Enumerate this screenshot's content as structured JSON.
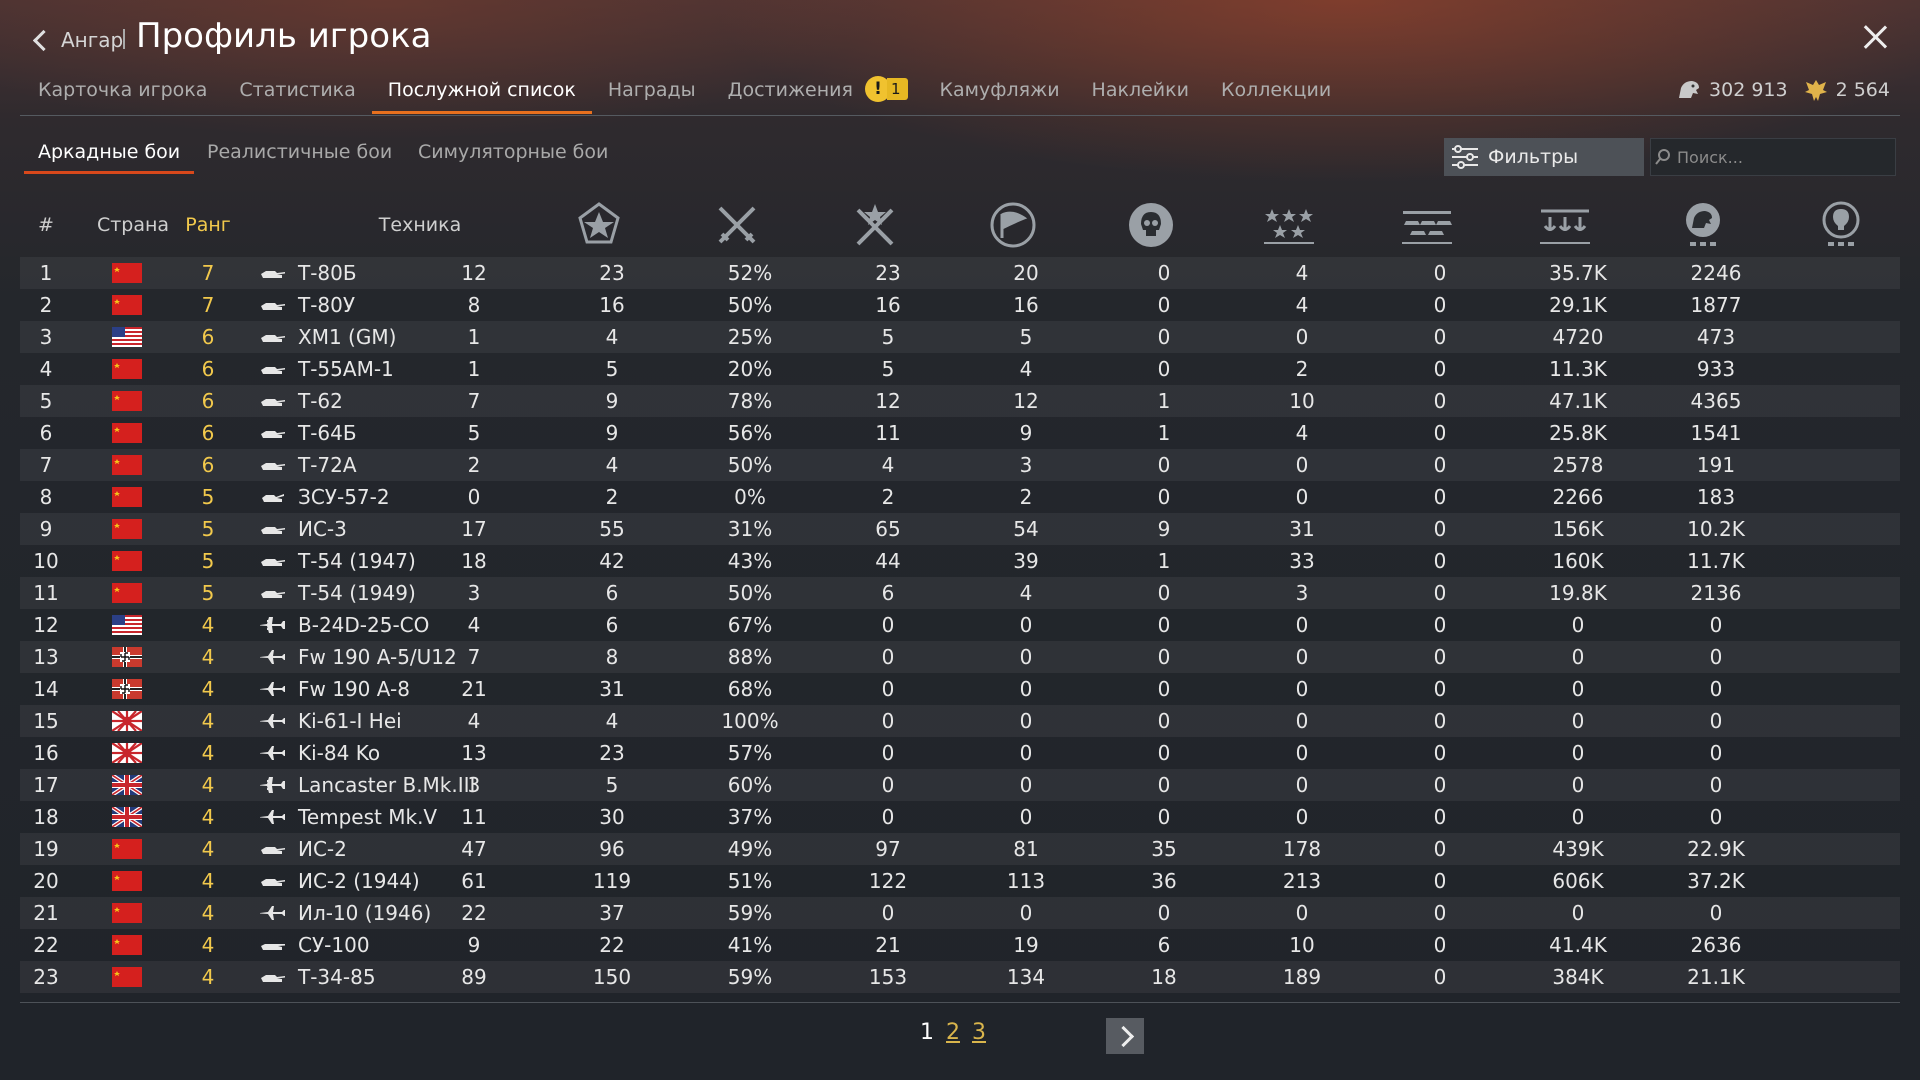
{
  "header": {
    "back_label": "Ангар",
    "title": "Профиль игрока",
    "tabs": [
      {
        "label": "Карточка игрока"
      },
      {
        "label": "Статистика"
      },
      {
        "label": "Послужной список",
        "active": true
      },
      {
        "label": "Награды"
      },
      {
        "label": "Достижения",
        "badge": "1"
      },
      {
        "label": "Камуфляжи"
      },
      {
        "label": "Наклейки"
      },
      {
        "label": "Коллекции"
      }
    ],
    "silver_lions": "302 913",
    "golden_eagles": "2 564"
  },
  "modes": {
    "items": [
      "Аркадные бои",
      "Реалистичные бои",
      "Симуляторные бои"
    ],
    "active_index": 0,
    "filters_label": "Фильтры",
    "search_placeholder": "Поиск..."
  },
  "table": {
    "headers": {
      "num": "#",
      "country": "Страна",
      "rank": "Ранг",
      "vehicle": "Техника"
    },
    "stat_icons": [
      "battles-icon",
      "victories-icon",
      "win-rate-icon",
      "captures-icon",
      "kills-icon",
      "multi-star-icon",
      "ground-kills-icon",
      "naval-kills-icon",
      "silver-lions-earned-icon",
      "research-points-icon"
    ],
    "rows": [
      {
        "n": "1",
        "country": "ussr",
        "rank": "7",
        "type": "tank",
        "name": "Т-80Б",
        "v": [
          "12",
          "23",
          "52%",
          "23",
          "20",
          "0",
          "4",
          "0",
          "35.7K",
          "2246"
        ]
      },
      {
        "n": "2",
        "country": "ussr",
        "rank": "7",
        "type": "tank",
        "name": "Т-80У",
        "v": [
          "8",
          "16",
          "50%",
          "16",
          "16",
          "0",
          "4",
          "0",
          "29.1K",
          "1877"
        ]
      },
      {
        "n": "3",
        "country": "usa",
        "rank": "6",
        "type": "tank",
        "name": "XM1 (GM)",
        "v": [
          "1",
          "4",
          "25%",
          "5",
          "5",
          "0",
          "0",
          "0",
          "4720",
          "473"
        ]
      },
      {
        "n": "4",
        "country": "ussr",
        "rank": "6",
        "type": "tank",
        "name": "Т-55АМ-1",
        "v": [
          "1",
          "5",
          "20%",
          "5",
          "4",
          "0",
          "2",
          "0",
          "11.3K",
          "933"
        ]
      },
      {
        "n": "5",
        "country": "ussr",
        "rank": "6",
        "type": "tank",
        "name": "Т-62",
        "v": [
          "7",
          "9",
          "78%",
          "12",
          "12",
          "1",
          "10",
          "0",
          "47.1K",
          "4365"
        ]
      },
      {
        "n": "6",
        "country": "ussr",
        "rank": "6",
        "type": "tank",
        "name": "Т-64Б",
        "v": [
          "5",
          "9",
          "56%",
          "11",
          "9",
          "1",
          "4",
          "0",
          "25.8K",
          "1541"
        ]
      },
      {
        "n": "7",
        "country": "ussr",
        "rank": "6",
        "type": "tank",
        "name": "Т-72А",
        "v": [
          "2",
          "4",
          "50%",
          "4",
          "3",
          "0",
          "0",
          "0",
          "2578",
          "191"
        ]
      },
      {
        "n": "8",
        "country": "ussr",
        "rank": "5",
        "type": "spaa",
        "name": "ЗСУ-57-2",
        "v": [
          "0",
          "2",
          "0%",
          "2",
          "2",
          "0",
          "0",
          "0",
          "2266",
          "183"
        ]
      },
      {
        "n": "9",
        "country": "ussr",
        "rank": "5",
        "type": "tank",
        "name": "ИС-3",
        "v": [
          "17",
          "55",
          "31%",
          "65",
          "54",
          "9",
          "31",
          "0",
          "156K",
          "10.2K"
        ]
      },
      {
        "n": "10",
        "country": "ussr",
        "rank": "5",
        "type": "tank",
        "name": "Т-54 (1947)",
        "v": [
          "18",
          "42",
          "43%",
          "44",
          "39",
          "1",
          "33",
          "0",
          "160K",
          "11.7K"
        ]
      },
      {
        "n": "11",
        "country": "ussr",
        "rank": "5",
        "type": "tank",
        "name": "Т-54 (1949)",
        "v": [
          "3",
          "6",
          "50%",
          "6",
          "4",
          "0",
          "3",
          "0",
          "19.8K",
          "2136"
        ]
      },
      {
        "n": "12",
        "country": "usa",
        "rank": "4",
        "type": "bomber",
        "name": "B-24D-25-CO",
        "v": [
          "4",
          "6",
          "67%",
          "0",
          "0",
          "0",
          "0",
          "0",
          "0",
          "0"
        ]
      },
      {
        "n": "13",
        "country": "germany",
        "rank": "4",
        "type": "plane",
        "name": "Fw 190 A-5/U12",
        "v": [
          "7",
          "8",
          "88%",
          "0",
          "0",
          "0",
          "0",
          "0",
          "0",
          "0"
        ]
      },
      {
        "n": "14",
        "country": "germany",
        "rank": "4",
        "type": "plane",
        "name": "Fw 190 A-8",
        "v": [
          "21",
          "31",
          "68%",
          "0",
          "0",
          "0",
          "0",
          "0",
          "0",
          "0"
        ]
      },
      {
        "n": "15",
        "country": "japan",
        "rank": "4",
        "type": "plane",
        "name": "Ki-61-I Hei",
        "v": [
          "4",
          "4",
          "100%",
          "0",
          "0",
          "0",
          "0",
          "0",
          "0",
          "0"
        ]
      },
      {
        "n": "16",
        "country": "japan",
        "rank": "4",
        "type": "plane",
        "name": "Ki-84 Ko",
        "v": [
          "13",
          "23",
          "57%",
          "0",
          "0",
          "0",
          "0",
          "0",
          "0",
          "0"
        ]
      },
      {
        "n": "17",
        "country": "uk",
        "rank": "4",
        "type": "bomber",
        "name": "Lancaster B.Mk.III",
        "v": [
          "3",
          "5",
          "60%",
          "0",
          "0",
          "0",
          "0",
          "0",
          "0",
          "0"
        ]
      },
      {
        "n": "18",
        "country": "uk",
        "rank": "4",
        "type": "plane",
        "name": "Tempest Mk.V",
        "v": [
          "11",
          "30",
          "37%",
          "0",
          "0",
          "0",
          "0",
          "0",
          "0",
          "0"
        ]
      },
      {
        "n": "19",
        "country": "ussr",
        "rank": "4",
        "type": "tank",
        "name": "ИС-2",
        "v": [
          "47",
          "96",
          "49%",
          "97",
          "81",
          "35",
          "178",
          "0",
          "439K",
          "22.9K"
        ]
      },
      {
        "n": "20",
        "country": "ussr",
        "rank": "4",
        "type": "tank",
        "name": "ИС-2 (1944)",
        "v": [
          "61",
          "119",
          "51%",
          "122",
          "113",
          "36",
          "213",
          "0",
          "606K",
          "37.2K"
        ]
      },
      {
        "n": "21",
        "country": "ussr",
        "rank": "4",
        "type": "plane",
        "name": "Ил-10 (1946)",
        "v": [
          "22",
          "37",
          "59%",
          "0",
          "0",
          "0",
          "0",
          "0",
          "0",
          "0"
        ]
      },
      {
        "n": "22",
        "country": "ussr",
        "rank": "4",
        "type": "spg",
        "name": "СУ-100",
        "v": [
          "9",
          "22",
          "41%",
          "21",
          "19",
          "6",
          "10",
          "0",
          "41.4K",
          "2636"
        ]
      },
      {
        "n": "23",
        "country": "ussr",
        "rank": "4",
        "type": "tank",
        "name": "Т-34-85",
        "v": [
          "89",
          "150",
          "59%",
          "153",
          "134",
          "18",
          "189",
          "0",
          "384K",
          "21.1K"
        ]
      }
    ]
  },
  "pagination": {
    "pages": [
      "1",
      "2",
      "3"
    ],
    "current": "1"
  },
  "colors": {
    "accent_tab": "#e8701e",
    "mode_underline": "#d9481b",
    "rank_text": "#f2c94c",
    "link": "#d9b54c"
  }
}
